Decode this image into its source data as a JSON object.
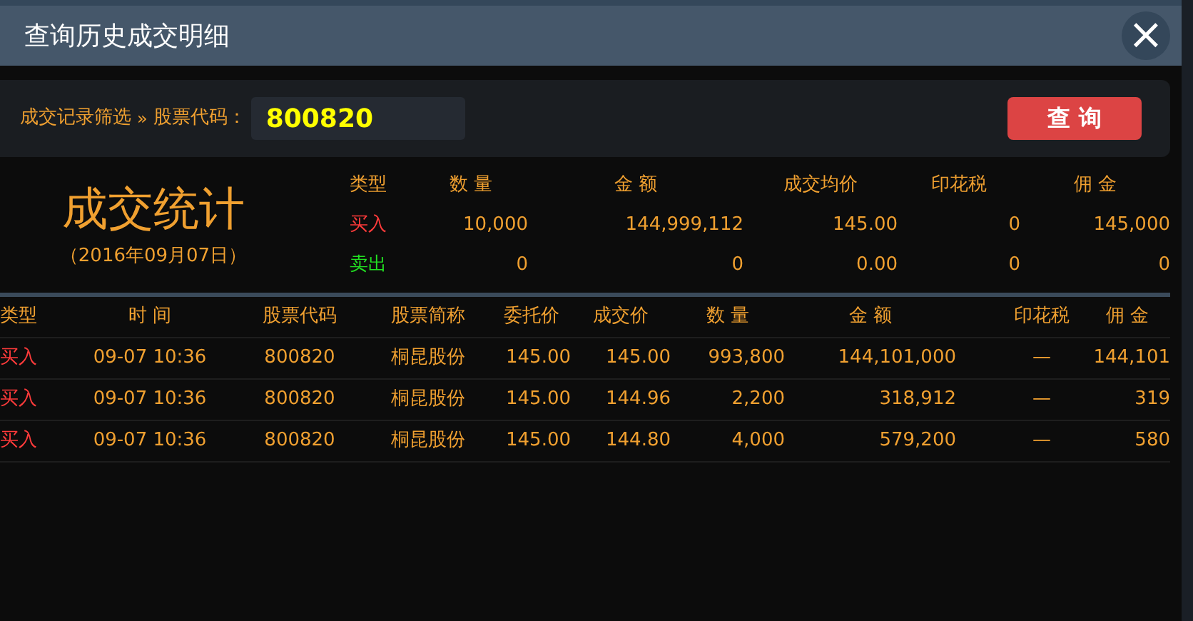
{
  "window": {
    "title": "查询历史成交明细",
    "close": "×"
  },
  "filter": {
    "label": "成交记录筛选",
    "separator": "»",
    "field_label": "股票代码：",
    "value": "800820",
    "button": "查 询"
  },
  "stats": {
    "title": "成交统计",
    "date": "（2016年09月07日）",
    "columns": [
      "类型",
      "数 量",
      "金 额",
      "成交均价",
      "印花税",
      "佣 金"
    ],
    "rows": [
      {
        "kind": "buy",
        "cells": [
          "买入",
          "10,000",
          "144,999,112",
          "145.00",
          "0",
          "145,000"
        ]
      },
      {
        "kind": "sell",
        "cells": [
          "卖出",
          "0",
          "0",
          "0.00",
          "0",
          "0"
        ]
      }
    ]
  },
  "table": {
    "columns": [
      "类型",
      "时 间",
      "股票代码",
      "股票简称",
      "委托价",
      "成交价",
      "数 量",
      "金 额",
      "印花税",
      "佣 金"
    ],
    "rows": [
      {
        "kind": "buy",
        "cells": [
          "买入",
          "09-07 10:36",
          "800820",
          "桐昆股份",
          "145.00",
          "145.00",
          "993,800",
          "144,101,000",
          "—",
          "144,101"
        ]
      },
      {
        "kind": "buy",
        "cells": [
          "买入",
          "09-07 10:36",
          "800820",
          "桐昆股份",
          "145.00",
          "144.96",
          "2,200",
          "318,912",
          "—",
          "319"
        ]
      },
      {
        "kind": "buy",
        "cells": [
          "买入",
          "09-07 10:36",
          "800820",
          "桐昆股份",
          "145.00",
          "144.80",
          "4,000",
          "579,200",
          "—",
          "580"
        ]
      }
    ]
  }
}
